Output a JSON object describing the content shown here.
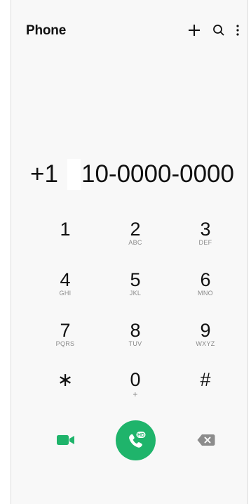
{
  "app": {
    "title": "Phone"
  },
  "header": {
    "add_icon": "plus-icon",
    "search_icon": "search-icon",
    "menu_icon": "more-vert-icon"
  },
  "display": {
    "prefix": "+1",
    "rest": "10-0000-0000"
  },
  "keypad": {
    "keys": [
      {
        "digit": "1",
        "letters": ""
      },
      {
        "digit": "2",
        "letters": "ABC"
      },
      {
        "digit": "3",
        "letters": "DEF"
      },
      {
        "digit": "4",
        "letters": "GHI"
      },
      {
        "digit": "5",
        "letters": "JKL"
      },
      {
        "digit": "6",
        "letters": "MNO"
      },
      {
        "digit": "7",
        "letters": "PQRS"
      },
      {
        "digit": "8",
        "letters": "TUV"
      },
      {
        "digit": "9",
        "letters": "WXYZ"
      },
      {
        "digit": "∗",
        "letters": ""
      },
      {
        "digit": "0",
        "letters": "+"
      },
      {
        "digit": "#",
        "letters": ""
      }
    ]
  },
  "actions": {
    "video_icon": "video-call-icon",
    "call_icon": "hd-voice-call-icon",
    "call_badge": "HD",
    "delete_icon": "backspace-icon"
  },
  "colors": {
    "accent": "#1fb46b",
    "text": "#111111",
    "secondary": "#8a8a8a",
    "delete": "#8c8c8c"
  }
}
